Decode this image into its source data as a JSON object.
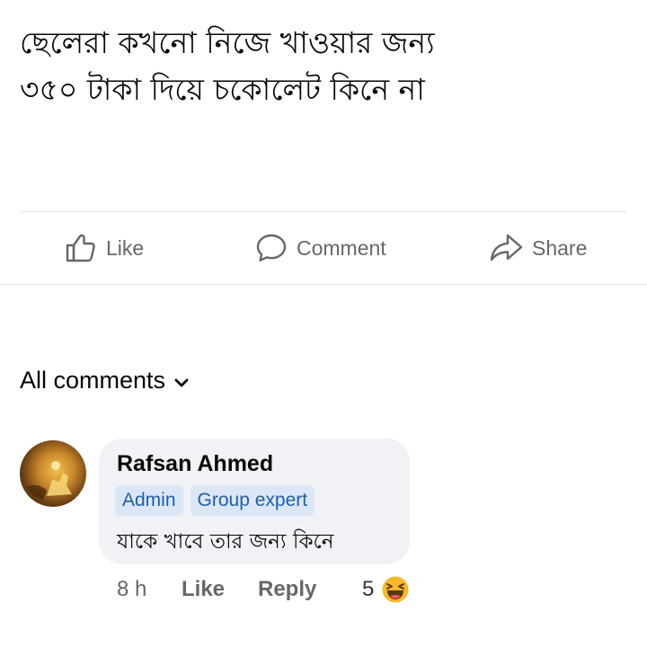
{
  "post": {
    "text_line_1": "ছেলেরা কখনো নিজে খাওয়ার জন্য",
    "text_line_2": "৩৫০ টাকা দিয়ে চকোলেট কিনে না"
  },
  "actions": {
    "like_label": "Like",
    "comment_label": "Comment",
    "share_label": "Share"
  },
  "comments_header": {
    "label": "All comments"
  },
  "comment": {
    "author": "Rafsan Ahmed",
    "badges": [
      "Admin",
      "Group expert"
    ],
    "text": "যাকে খাবে তার জন্য কিনে",
    "time": "8 h",
    "like_label": "Like",
    "reply_label": "Reply",
    "reaction_count": "5",
    "reaction_icon": "haha-emoji-icon"
  },
  "colors": {
    "action_gray": "#65676b",
    "bubble_bg": "#f0f2f5",
    "badge_bg": "#dbe7f6",
    "badge_text": "#1f5fa8",
    "emoji_yellow": "#f7b928"
  }
}
